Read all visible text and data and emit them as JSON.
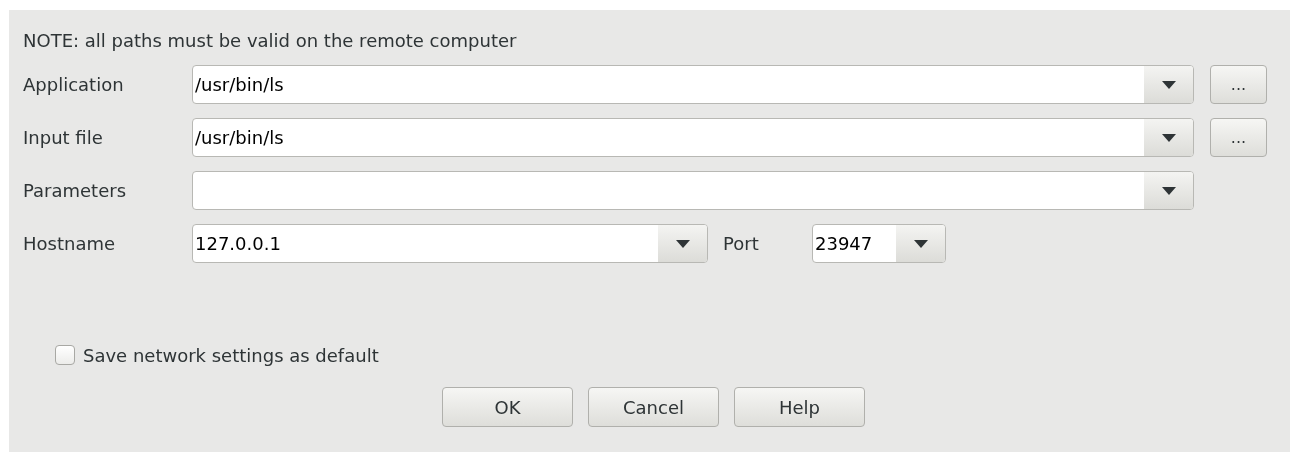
{
  "note": "NOTE: all paths must be valid on the remote computer",
  "fields": [
    {
      "label": "Application",
      "value": "/usr/bin/ls",
      "browse": "..."
    },
    {
      "label": "Input file",
      "value": "/usr/bin/ls",
      "browse": "..."
    },
    {
      "label": "Parameters"
    }
  ],
  "hostname": {
    "label": "Hostname",
    "value": "127.0.0.1"
  },
  "port": {
    "label": "Port",
    "value": "23947"
  },
  "save_default": {
    "label": "Save network settings as default",
    "checked": false
  },
  "buttons": [
    {
      "label": "OK"
    },
    {
      "label": "Cancel"
    },
    {
      "label": "Help"
    }
  ]
}
